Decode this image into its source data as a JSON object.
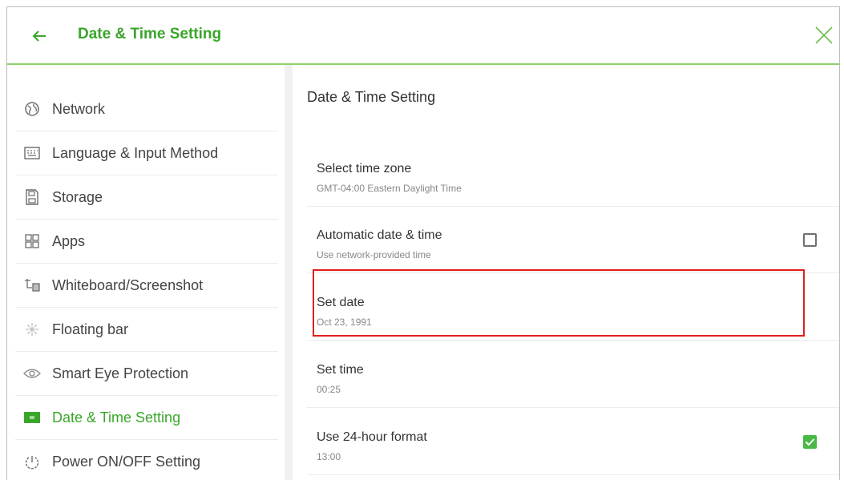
{
  "titlebar": {
    "back_icon": "arrow-left-icon",
    "title": "Date & Time Setting",
    "close_icon": "close-icon",
    "accent_color": "#3aa52a"
  },
  "sidebar": {
    "items": [
      {
        "label": "Network",
        "icon": "globe-icon"
      },
      {
        "label": "Language & Input Method",
        "icon": "keyboard-icon"
      },
      {
        "label": "Storage",
        "icon": "storage-icon"
      },
      {
        "label": "Apps",
        "icon": "apps-grid-icon"
      },
      {
        "label": "Whiteboard/Screenshot",
        "icon": "whiteboard-icon"
      },
      {
        "label": "Floating bar",
        "icon": "floating-bar-icon"
      },
      {
        "label": "Smart Eye Protection",
        "icon": "eye-icon"
      },
      {
        "label": "Date & Time Setting",
        "icon": "calendar-icon",
        "active": true
      },
      {
        "label": "Power ON/OFF Setting",
        "icon": "power-icon"
      }
    ]
  },
  "content": {
    "title": "Date & Time Setting",
    "rows": [
      {
        "title": "Select time zone",
        "subtitle": "GMT-04:00 Eastern Daylight Time"
      },
      {
        "title": "Automatic date & time",
        "subtitle": "Use network-provided time",
        "checked": false
      },
      {
        "title": "Set date",
        "subtitle": "Oct 23, 1991"
      },
      {
        "title": "Set time",
        "subtitle": "00:25"
      },
      {
        "title": "Use 24-hour format",
        "subtitle": "13:00",
        "checked": true
      }
    ]
  },
  "colors": {
    "highlight": "#e31d1d",
    "check_green": "#48b944"
  }
}
